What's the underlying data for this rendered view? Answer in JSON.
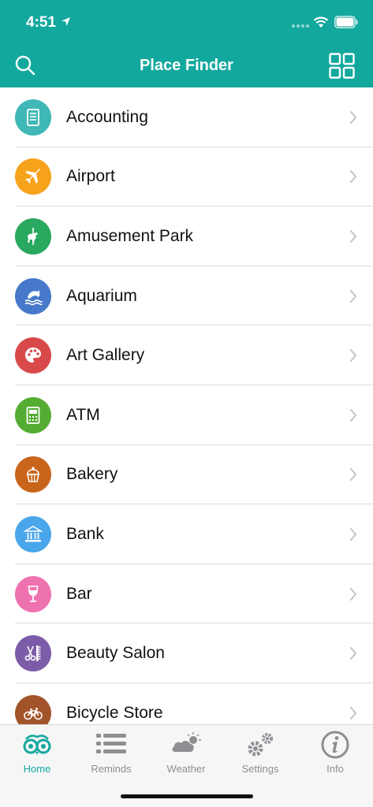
{
  "status_bar": {
    "time": "4:51"
  },
  "nav": {
    "title": "Place Finder",
    "search_icon": "search-icon",
    "grid_icon": "grid-view-icon"
  },
  "colors": {
    "header": "#13a89e",
    "active_tab": "#13a89e",
    "inactive_tab": "#8e8e93"
  },
  "categories": [
    {
      "label": "Accounting",
      "icon": "document-icon",
      "color": "#3fb8b7"
    },
    {
      "label": "Airport",
      "icon": "airplane-icon",
      "color": "#f7a21b"
    },
    {
      "label": "Amusement Park",
      "icon": "carousel-horse-icon",
      "color": "#29a960"
    },
    {
      "label": "Aquarium",
      "icon": "dolphin-icon",
      "color": "#4679c9"
    },
    {
      "label": "Art Gallery",
      "icon": "palette-icon",
      "color": "#d84a4a"
    },
    {
      "label": "ATM",
      "icon": "atm-machine-icon",
      "color": "#55ac32"
    },
    {
      "label": "Bakery",
      "icon": "cupcake-icon",
      "color": "#c8651b"
    },
    {
      "label": "Bank",
      "icon": "bank-building-icon",
      "color": "#4aa6ea"
    },
    {
      "label": "Bar",
      "icon": "wine-glass-icon",
      "color": "#ef72b0"
    },
    {
      "label": "Beauty Salon",
      "icon": "scissors-comb-icon",
      "color": "#7c5ca8"
    },
    {
      "label": "Bicycle Store",
      "icon": "bicycle-icon",
      "color": "#a3532a"
    }
  ],
  "tabs": [
    {
      "label": "Home",
      "icon": "owl-glasses-icon",
      "active": true
    },
    {
      "label": "Reminds",
      "icon": "list-icon",
      "active": false
    },
    {
      "label": "Weather",
      "icon": "cloud-sun-icon",
      "active": false
    },
    {
      "label": "Settings",
      "icon": "gears-icon",
      "active": false
    },
    {
      "label": "Info",
      "icon": "info-icon",
      "active": false
    }
  ]
}
